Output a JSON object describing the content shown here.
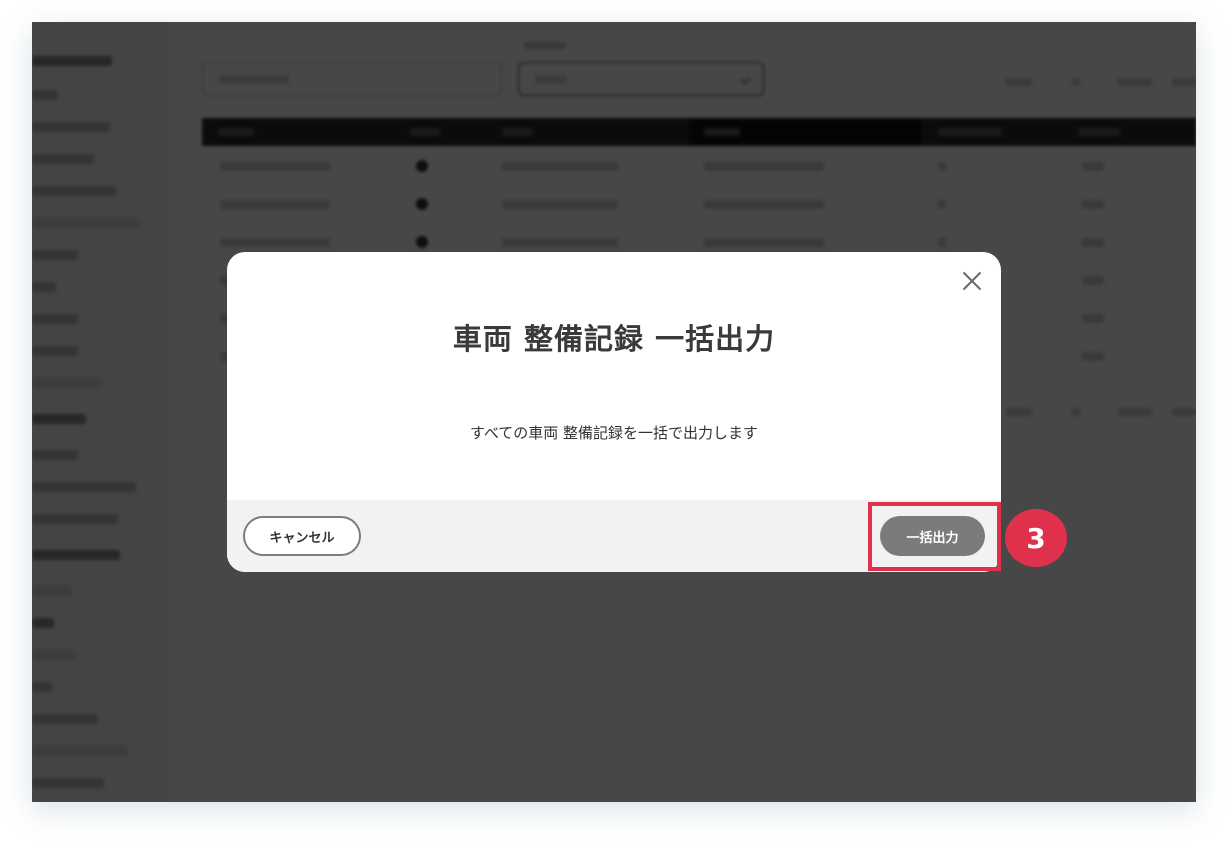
{
  "dialog": {
    "title": "車両 整備記録 一括出力",
    "message": "すべての車両 整備記録を一括で出力します",
    "cancel_label": "キャンセル",
    "export_label": "一括出力"
  },
  "annotation": {
    "step_number": "3",
    "highlight_color": "#e0314c"
  },
  "colors": {
    "overlay": "rgba(0,0,0,0.72)",
    "primary_button": "#7b7b7b",
    "footer": "#f2f2f2"
  }
}
